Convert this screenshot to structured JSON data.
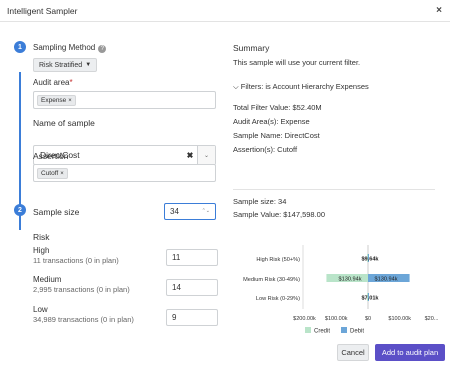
{
  "header": {
    "title": "Intelligent Sampler",
    "close": "×"
  },
  "steps": {
    "one": "1",
    "two": "2"
  },
  "sampling_method": {
    "label": "Sampling Method",
    "help_icon": "?",
    "value": "Risk Stratified",
    "caret": "▼"
  },
  "audit_area": {
    "label": "Audit area",
    "required_mark": "*",
    "tag": "Expense",
    "tag_remove": "×"
  },
  "sample_name": {
    "label": "Name of sample",
    "value": "DirectCost",
    "clear": "✖",
    "arrow": "⌄"
  },
  "assertion": {
    "label": "Assertion",
    "tag": "Cutoff",
    "tag_remove": "×"
  },
  "sample_size": {
    "label": "Sample size",
    "value": "34",
    "spinner": "⌃⌄"
  },
  "risk": {
    "label": "Risk",
    "rows": [
      {
        "name": "High",
        "detail": "11 transactions (0 in plan)",
        "value": "11"
      },
      {
        "name": "Medium",
        "detail": "2,995 transactions (0 in plan)",
        "value": "14"
      },
      {
        "name": "Low",
        "detail": "34,989 transactions (0 in plan)",
        "value": "9"
      }
    ]
  },
  "summary": {
    "title": "Summary",
    "note": "This sample will use your current filter.",
    "filters_toggle": "⌵",
    "filters": "Filters: is Account Hierarchy Expenses",
    "total_filter_value": "Total Filter Value: $52.40M",
    "audit_areas": "Audit Area(s): Expense",
    "sample_name": "Sample Name: DirectCost",
    "assertions": "Assertion(s): Cutoff",
    "sample_size": "Sample size: 34",
    "sample_value": "Sample Value: $147,598.00"
  },
  "chart_data": {
    "type": "bar",
    "orientation": "horizontal",
    "stacked": "diverging",
    "categories": [
      "High Risk (50+%)",
      "Medium Risk (30-49%)",
      "Low Risk (0-29%)"
    ],
    "series": [
      {
        "name": "Credit",
        "values": [
          -1.5,
          -130.94,
          -1.5
        ]
      },
      {
        "name": "Debit",
        "values": [
          1.5,
          130.94,
          1.5
        ]
      }
    ],
    "data_labels": [
      "$9.64k",
      "$130.94k",
      "$130.94k",
      "$7.01k"
    ],
    "x_ticks": [
      "$200.00k",
      "$100.00k",
      "$0",
      "$100.00k",
      "$20..."
    ],
    "xlim": [
      -200,
      200
    ],
    "legend": "bottom",
    "colors": {
      "credit": "#b9e4c9",
      "debit": "#6ca6d8"
    }
  },
  "buttons": {
    "cancel": "Cancel",
    "add": "Add to audit plan"
  },
  "colors": {
    "accent": "#3b7dd8",
    "primary_button": "#5b4fc7"
  }
}
